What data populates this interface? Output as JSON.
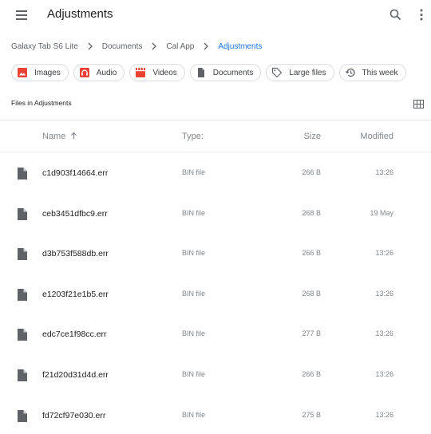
{
  "header": {
    "title": "Adjustments"
  },
  "breadcrumb": [
    "Galaxy Tab S6 Lite",
    "Documents",
    "Cal App",
    "Adjustments"
  ],
  "chips": [
    {
      "label": "Images",
      "icon": "image-icon"
    },
    {
      "label": "Audio",
      "icon": "headphones-icon"
    },
    {
      "label": "Videos",
      "icon": "film-icon"
    },
    {
      "label": "Documents",
      "icon": "document-icon"
    },
    {
      "label": "Large files",
      "icon": "tag-icon"
    },
    {
      "label": "This week",
      "icon": "history-icon"
    }
  ],
  "section_title": "Files in Adjustments",
  "columns": {
    "name": "Name",
    "type": "Type:",
    "size": "Size",
    "modified": "Modified"
  },
  "files": [
    {
      "name": "c1d903f14664.err",
      "type": "BIN file",
      "size": "266 B",
      "modified": "13:26"
    },
    {
      "name": "ceb3451dfbc9.err",
      "type": "BIN file",
      "size": "268 B",
      "modified": "19 May"
    },
    {
      "name": "d3b753f588db.err",
      "type": "BIN file",
      "size": "266 B",
      "modified": "13:26"
    },
    {
      "name": "e1203f21e1b5.err",
      "type": "BIN file",
      "size": "268 B",
      "modified": "13:26"
    },
    {
      "name": "edc7ce1f98cc.err",
      "type": "BIN file",
      "size": "277 B",
      "modified": "13:26"
    },
    {
      "name": "f21d20d31d4d.err",
      "type": "BIN file",
      "size": "266 B",
      "modified": "13:26"
    },
    {
      "name": "fd72cf97e030.err",
      "type": "BIN file",
      "size": "275 B",
      "modified": "13:26"
    }
  ],
  "colors": {
    "accent": "#1a73e8",
    "chip_image": "#ea4335",
    "chip_audio": "#ea4335",
    "chip_video": "#ea4335",
    "icon_gray": "#5f6368"
  }
}
